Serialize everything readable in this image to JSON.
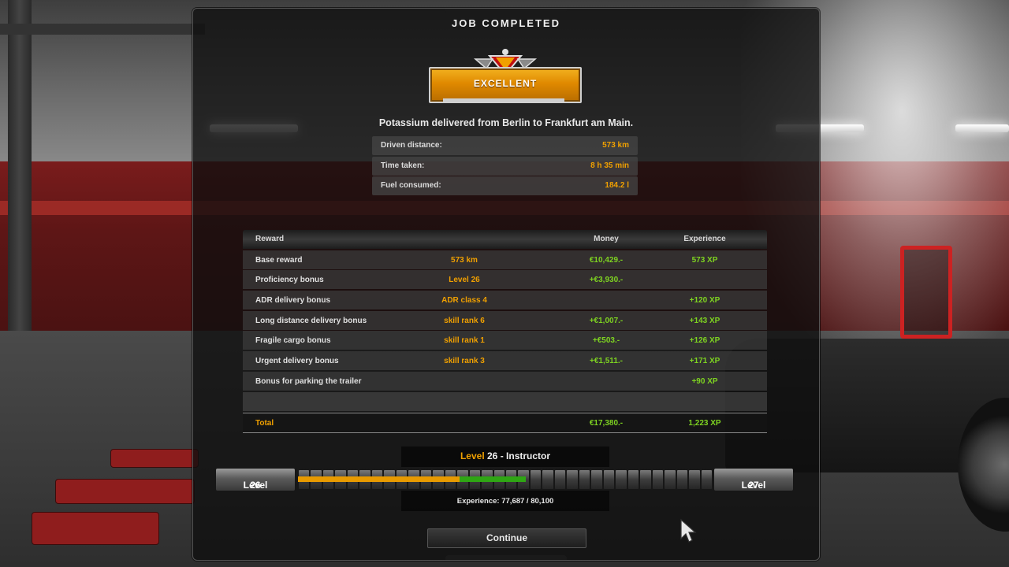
{
  "dialog": {
    "title": "JOB COMPLETED",
    "rating": "EXCELLENT",
    "delivery_summary": "Potassium delivered from Berlin to Frankfurt am Main."
  },
  "stats": [
    {
      "label": "Driven distance:",
      "value": "573 km"
    },
    {
      "label": "Time taken:",
      "value": "8 h 35 min"
    },
    {
      "label": "Fuel consumed:",
      "value": "184.2 l"
    }
  ],
  "rewards": {
    "headers": {
      "reward": "Reward",
      "money": "Money",
      "experience": "Experience"
    },
    "rows": [
      {
        "name": "Base reward",
        "detail": "573 km",
        "money": "€10,429.-",
        "xp": "573 XP"
      },
      {
        "name": "Proficiency bonus",
        "detail": "Level 26",
        "money": "+€3,930.-",
        "xp": ""
      },
      {
        "name": "ADR delivery bonus",
        "detail": "ADR class 4",
        "money": "",
        "xp": "+120 XP"
      },
      {
        "name": "Long distance delivery bonus",
        "detail": "skill rank 6",
        "money": "+€1,007.-",
        "xp": "+143 XP"
      },
      {
        "name": "Fragile cargo bonus",
        "detail": "skill rank 1",
        "money": "+€503.-",
        "xp": "+126 XP"
      },
      {
        "name": "Urgent delivery bonus",
        "detail": "skill rank 3",
        "money": "+€1,511.-",
        "xp": "+171 XP"
      },
      {
        "name": "Bonus for parking the trailer",
        "detail": "",
        "money": "",
        "xp": "+90 XP"
      }
    ],
    "total": {
      "label": "Total",
      "money": "€17,380.-",
      "xp": "1,223 XP"
    }
  },
  "level": {
    "word": "Level",
    "current": "26",
    "rank_suffix": " - Instructor",
    "next": "27",
    "experience_text": "Experience: 77,687 / 80,100",
    "progress_previous_fraction": 0.39,
    "progress_gained_fraction": 0.16
  },
  "buttons": {
    "continue": "Continue"
  },
  "colors": {
    "accent": "#f0a000",
    "xp_green": "#7ed321",
    "bar_orange": "#e89a00",
    "bar_green": "#2fa614"
  }
}
